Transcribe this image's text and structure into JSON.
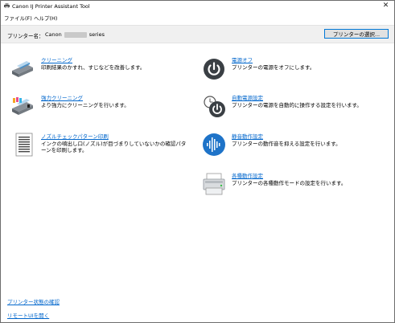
{
  "window": {
    "title": "Canon IJ Printer Assistant Tool",
    "close_glyph": "✕"
  },
  "menu": {
    "file": "ファイル(F)",
    "help": "ヘルプ(H)"
  },
  "printer": {
    "label": "プリンター名：",
    "name_prefix": "Canon",
    "name_suffix": "series",
    "select_button": "プリンターの選択..."
  },
  "functions": {
    "cleaning": {
      "title": "クリーニング",
      "desc": "印刷結果のかすれ、すじなどを改善します。",
      "icon": "cleaning-icon"
    },
    "deep_cleaning": {
      "title": "強力クリーニング",
      "desc": "より強力にクリーニングを行います。",
      "icon": "deep-cleaning-icon"
    },
    "nozzle_check": {
      "title": "ノズルチェックパターン印刷",
      "desc": "インクの噴出し口(ノズル)が目づまりしていないかの確認パターンを印刷します。",
      "icon": "nozzle-check-pattern-icon"
    },
    "power_off": {
      "title": "電源オフ",
      "desc": "プリンターの電源をオフにします。",
      "icon": "power-icon"
    },
    "auto_power": {
      "title": "自動電源設定",
      "desc": "プリンターの電源を自動的に操作する設定を行います。",
      "icon": "auto-power-icon"
    },
    "quiet": {
      "title": "静音動作設定",
      "desc": "プリンターの動作音を抑える設定を行います。",
      "icon": "quiet-mode-icon"
    },
    "custom": {
      "title": "各種動作設定",
      "desc": "プリンターの各種動作モードの設定を行います。",
      "icon": "printer-settings-icon"
    }
  },
  "links": {
    "status": "プリンター状態の確認",
    "remote_ui": "リモートUIを開く"
  },
  "colors": {
    "link": "#0066cc",
    "accent_blue": "#0078d7",
    "icon_dark": "#3a3f44"
  }
}
